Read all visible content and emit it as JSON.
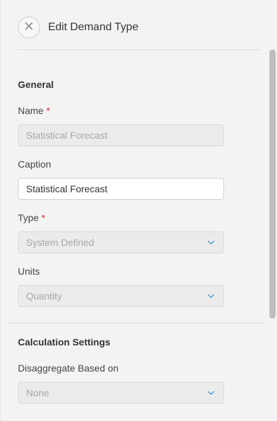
{
  "dialog": {
    "title": "Edit Demand Type",
    "close_icon": "close-icon"
  },
  "general": {
    "section_title": "General",
    "name": {
      "label": "Name",
      "required_mark": "*",
      "value": "Statistical Forecast"
    },
    "caption": {
      "label": "Caption",
      "value": "Statistical Forecast"
    },
    "type": {
      "label": "Type",
      "required_mark": "*",
      "value": "System Defined",
      "icon": "chevron-down-icon"
    },
    "units": {
      "label": "Units",
      "value": "Quantity",
      "icon": "chevron-down-icon"
    }
  },
  "calculation": {
    "section_title": "Calculation Settings",
    "disaggregate": {
      "label": "Disaggregate Based on",
      "value": "None",
      "icon": "chevron-down-icon"
    }
  },
  "colors": {
    "accent": "#2a8fd6",
    "required": "#d62b2b",
    "disabled_bg": "#ebebeb",
    "disabled_text": "#a8a8a8"
  }
}
